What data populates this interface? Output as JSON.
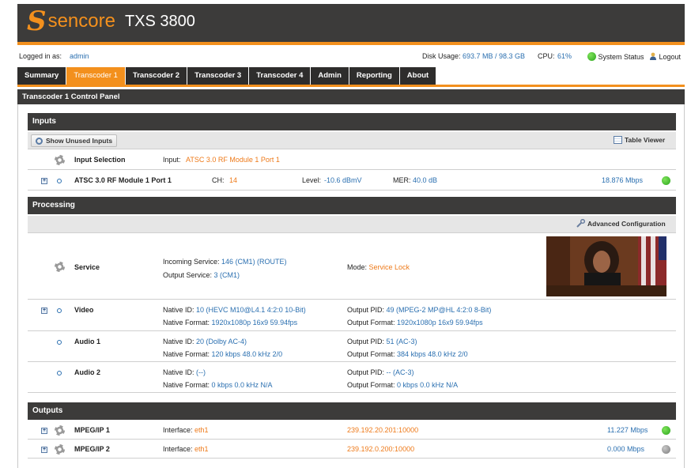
{
  "header": {
    "brand_s": "S",
    "brand": "sencore",
    "model": "TXS 3800"
  },
  "session": {
    "logged_in_label": "Logged in as:",
    "user": "admin",
    "disk_label": "Disk Usage:",
    "disk_value": "693.7 MB / 98.3 GB",
    "cpu_label": "CPU:",
    "cpu_value": "61%",
    "system_status": "System Status",
    "logout": "Logout"
  },
  "tabs": [
    "Summary",
    "Transcoder 1",
    "Transcoder 2",
    "Transcoder 3",
    "Transcoder 4",
    "Admin",
    "Reporting",
    "About"
  ],
  "active_tab": "Transcoder 1",
  "panel_title": "Transcoder 1 Control Panel",
  "inputs": {
    "title": "Inputs",
    "show_unused": "Show Unused Inputs",
    "table_viewer": "Table Viewer",
    "selection_label": "Input Selection",
    "selection_key": "Input:",
    "selection_value": "ATSC 3.0 RF Module 1 Port 1",
    "port_name": "ATSC 3.0 RF Module 1 Port 1",
    "ch_label": "CH:",
    "ch_value": "14",
    "level_label": "Level:",
    "level_value": "-10.6 dBmV",
    "mer_label": "MER:",
    "mer_value": "40.0 dB",
    "bitrate": "18.876",
    "bitrate_unit": "Mbps"
  },
  "processing": {
    "title": "Processing",
    "advanced": "Advanced Configuration",
    "service": {
      "label": "Service",
      "incoming_key": "Incoming Service:",
      "incoming_value": "146 (CM1) (ROUTE)",
      "output_key": "Output Service:",
      "output_value": "3 (CM1)",
      "mode_key": "Mode:",
      "mode_value": "Service Lock"
    },
    "video": {
      "label": "Video",
      "native_id_key": "Native ID:",
      "native_id_value": "10 (HEVC  M10@L4.1  4:2:0 10-Bit)",
      "native_format_key": "Native Format:",
      "native_format_value": "1920x1080p 16x9 59.94fps",
      "output_pid_key": "Output PID:",
      "output_pid_value": "49 (MPEG-2  MP@HL  4:2:0 8-Bit)",
      "output_format_key": "Output Format:",
      "output_format_value": "1920x1080p 16x9 59.94fps"
    },
    "audio1": {
      "label": "Audio 1",
      "native_id_key": "Native ID:",
      "native_id_value": "20 (Dolby AC-4)",
      "native_format_key": "Native Format:",
      "native_format_value": "120 kbps 48.0 kHz  2/0",
      "output_pid_key": "Output PID:",
      "output_pid_value": "51 (AC-3)",
      "output_format_key": "Output Format:",
      "output_format_value": "384 kbps 48.0 kHz  2/0"
    },
    "audio2": {
      "label": "Audio 2",
      "native_id_key": "Native ID:",
      "native_id_value": "(--)",
      "native_format_key": "Native Format:",
      "native_format_value": "0 kbps 0.0 kHz    N/A",
      "output_pid_key": "Output PID:",
      "output_pid_value": "-- (AC-3)",
      "output_format_key": "Output Format:",
      "output_format_value": "0 kbps 0.0 kHz    N/A"
    }
  },
  "outputs": {
    "title": "Outputs",
    "items": [
      {
        "name": "MPEG/IP 1",
        "iface_key": "Interface:",
        "iface_value": "eth1",
        "address": "239.192.20.201:10000",
        "bitrate": "11.227",
        "unit": "Mbps",
        "status": "green"
      },
      {
        "name": "MPEG/IP 2",
        "iface_key": "Interface:",
        "iface_value": "eth1",
        "address": "239.192.0.200:10000",
        "bitrate": "0.000",
        "unit": "Mbps",
        "status": "gray"
      }
    ]
  },
  "colors": {
    "accent": "#f3901d",
    "header_bg": "#3c3b3a",
    "value_blue": "#2a6fb0",
    "value_orange": "#ee7a1a",
    "ok_green": "#2aa51d",
    "idle_gray": "#7b7b7b"
  }
}
